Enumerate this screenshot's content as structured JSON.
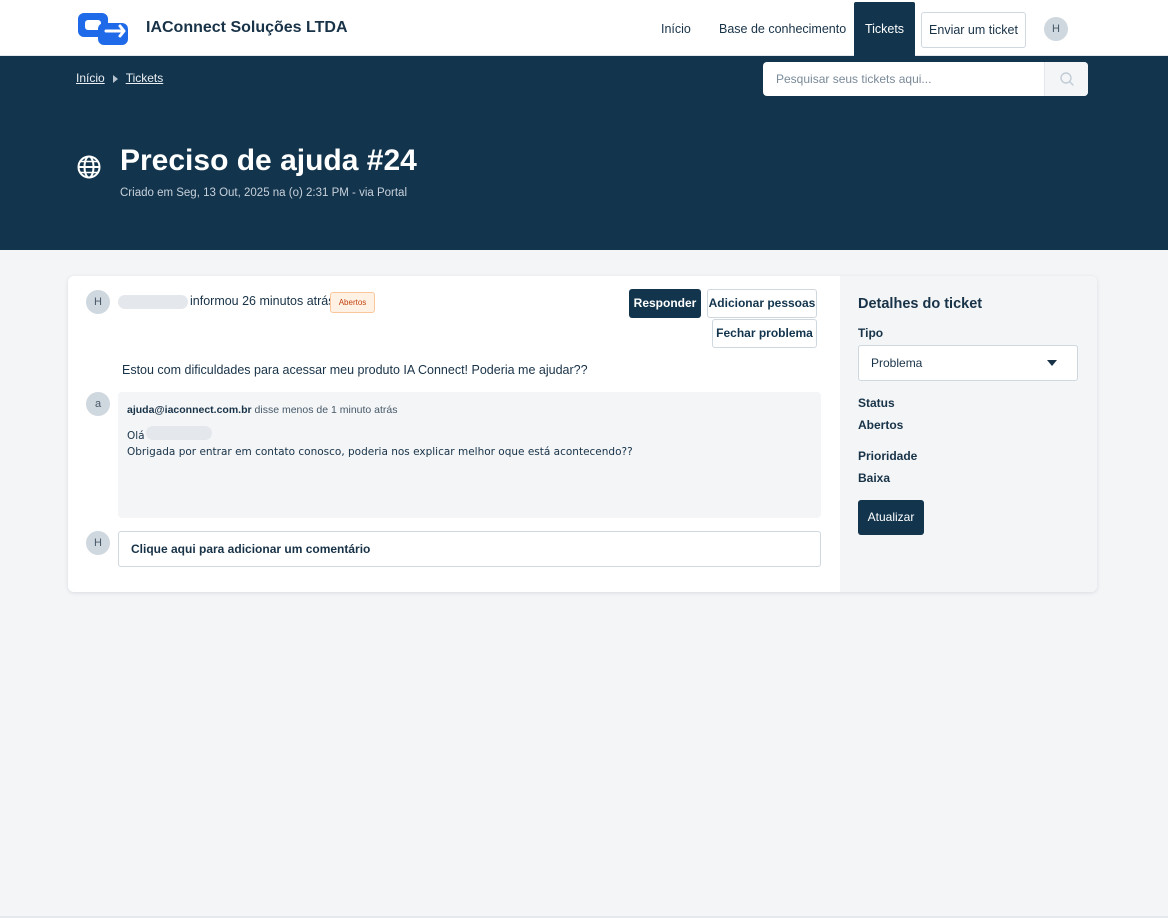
{
  "header": {
    "brand": "IAConnect Soluções LTDA",
    "nav": {
      "inicio": "Início",
      "kb": "Base de conhecimento",
      "tickets": "Tickets",
      "submit": "Enviar um ticket"
    },
    "user_initial": "H"
  },
  "breadcrumb": {
    "home": "Início",
    "tickets": "Tickets"
  },
  "search": {
    "placeholder": "Pesquisar seus tickets aqui..."
  },
  "ticket": {
    "title": "Preciso de ajuda #24",
    "created": "Criado em Seg, 13 Out, 2025 na (o) 2:31 PM - via Portal",
    "author_initial": "H",
    "reported": "informou 26 minutos atrás",
    "status_badge": "Abertos",
    "message": "Estou com dificuldades para acessar meu produto IA Connect! Poderia me ajudar??"
  },
  "actions": {
    "reply": "Responder",
    "add_people": "Adicionar pessoas",
    "close": "Fechar problema"
  },
  "reply": {
    "author_initial": "a",
    "author": "ajuda@iaconnect.com.br",
    "said": "disse menos de 1 minuto atrás",
    "greeting": "Olá",
    "body": "Obrigada por entrar em contato conosco, poderia nos explicar melhor oque está acontecendo??"
  },
  "comment": {
    "author_initial": "H",
    "placeholder": "Clique aqui para adicionar um comentário"
  },
  "details": {
    "title": "Detalhes do ticket",
    "type_label": "Tipo",
    "type_value": "Problema",
    "status_label": "Status",
    "status_value": "Abertos",
    "priority_label": "Prioridade",
    "priority_value": "Baixa",
    "update": "Atualizar"
  },
  "colors": {
    "brand_dark": "#12344d",
    "logo_blue": "#1e6ae8",
    "badge_bg": "#fff2e5",
    "badge_text": "#c2410c"
  },
  "icons": [
    "logo-icon",
    "globe-icon",
    "search-icon",
    "caret-down-icon"
  ]
}
